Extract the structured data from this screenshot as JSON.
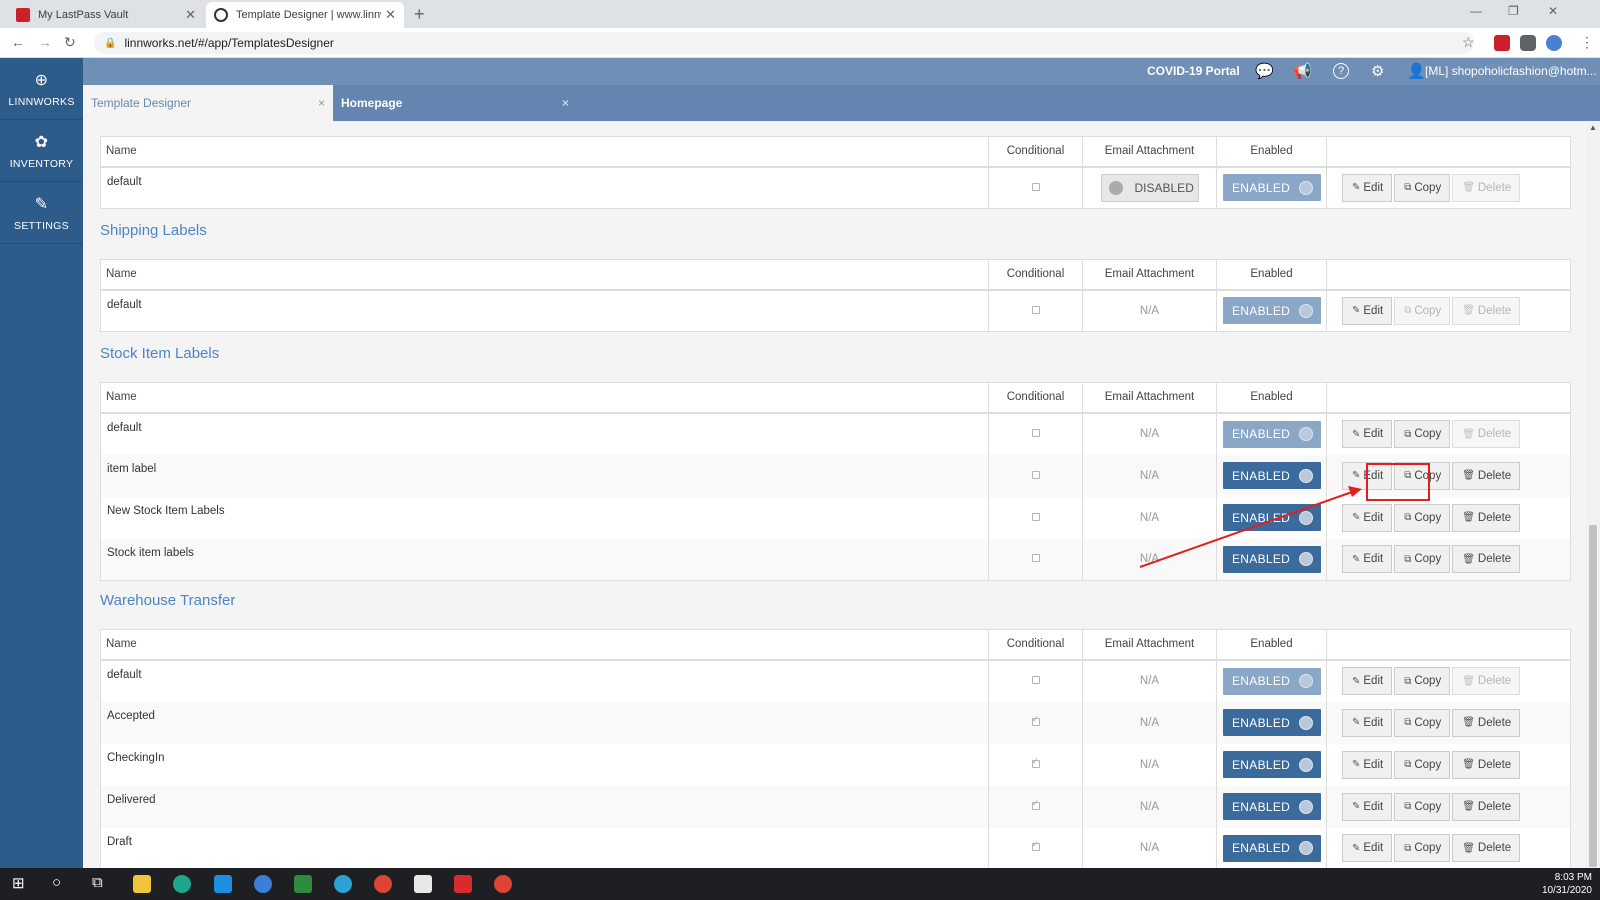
{
  "browser": {
    "tabs": [
      {
        "title": "My LastPass Vault",
        "close": "✕"
      },
      {
        "title": "Template Designer | www.linnwo",
        "close": "✕"
      }
    ],
    "new_tab": "+",
    "url": "linnworks.net/#/app/TemplatesDesigner",
    "window_controls": {
      "minimize": "—",
      "maximize": "❐",
      "close": "✕"
    },
    "nav": {
      "back": "←",
      "forward": "→",
      "reload": "↻",
      "star": "☆",
      "menu": "⋮"
    }
  },
  "sidebar": {
    "items": [
      {
        "label": "LINNWORKS",
        "icon": "linnworks-logo-icon",
        "glyph": "⊕"
      },
      {
        "label": "INVENTORY",
        "icon": "boxes-icon",
        "glyph": "✿"
      },
      {
        "label": "SETTINGS",
        "icon": "wrench-icon",
        "glyph": "✎"
      }
    ]
  },
  "header": {
    "covid_link": "COVID-19 Portal",
    "icons": {
      "chat": "💬",
      "megaphone": "📢",
      "help": "?",
      "settings": "⚙",
      "user": "👤"
    },
    "user": "[ML] shopoholicfashion@hotm..."
  },
  "app_tabs": [
    {
      "label": "Template Designer",
      "close": "×"
    },
    {
      "label": "Homepage",
      "close": "×"
    }
  ],
  "columns": {
    "name": "Name",
    "conditional": "Conditional",
    "attachment": "Email Attachment",
    "enabled": "Enabled"
  },
  "buttons": {
    "edit": "Edit",
    "copy": "Copy",
    "delete": "Delete"
  },
  "toggle": {
    "enabled": "ENABLED",
    "disabled": "DISABLED"
  },
  "sections": [
    {
      "title": "",
      "rows": [
        {
          "name": "default",
          "conditional": false,
          "attachment": "DISABLED",
          "attachment_toggle": true,
          "enabled_dim": true,
          "copy_disabled": false,
          "delete_disabled": true
        }
      ]
    },
    {
      "title": "Shipping Labels",
      "rows": [
        {
          "name": "default",
          "conditional": false,
          "attachment": "N/A",
          "enabled_dim": true,
          "copy_disabled": true,
          "delete_disabled": true
        }
      ]
    },
    {
      "title": "Stock Item Labels",
      "rows": [
        {
          "name": "default",
          "conditional": false,
          "attachment": "N/A",
          "enabled_dim": true,
          "copy_disabled": false,
          "delete_disabled": true
        },
        {
          "name": "item label",
          "conditional": false,
          "attachment": "N/A",
          "enabled_dim": false,
          "copy_disabled": false,
          "delete_disabled": false
        },
        {
          "name": "New Stock Item Labels",
          "conditional": false,
          "attachment": "N/A",
          "enabled_dim": false,
          "copy_disabled": false,
          "delete_disabled": false
        },
        {
          "name": "Stock item labels",
          "conditional": false,
          "attachment": "N/A",
          "enabled_dim": false,
          "copy_disabled": false,
          "delete_disabled": false
        }
      ]
    },
    {
      "title": "Warehouse Transfer",
      "rows": [
        {
          "name": "default",
          "conditional": false,
          "attachment": "N/A",
          "enabled_dim": true,
          "copy_disabled": false,
          "delete_disabled": true
        },
        {
          "name": "Accepted",
          "conditional": true,
          "attachment": "N/A",
          "enabled_dim": false,
          "copy_disabled": false,
          "delete_disabled": false
        },
        {
          "name": "CheckingIn",
          "conditional": true,
          "attachment": "N/A",
          "enabled_dim": false,
          "copy_disabled": false,
          "delete_disabled": false
        },
        {
          "name": "Delivered",
          "conditional": true,
          "attachment": "N/A",
          "enabled_dim": false,
          "copy_disabled": false,
          "delete_disabled": false
        },
        {
          "name": "Draft",
          "conditional": true,
          "attachment": "N/A",
          "enabled_dim": false,
          "copy_disabled": false,
          "delete_disabled": false
        }
      ]
    }
  ],
  "taskbar": {
    "time": "8:03 PM",
    "date": "10/31/2020",
    "start": "⊞",
    "search": "○",
    "taskview": "⧉"
  },
  "colors": {
    "sidebar": "#2d5b8a",
    "header": "#6f8fb6",
    "section_title": "#4a86c5",
    "toggle_enabled": "#3b6a9c",
    "toggle_enabled_dim": "#8aa7c8",
    "highlight": "#e21f1f"
  }
}
